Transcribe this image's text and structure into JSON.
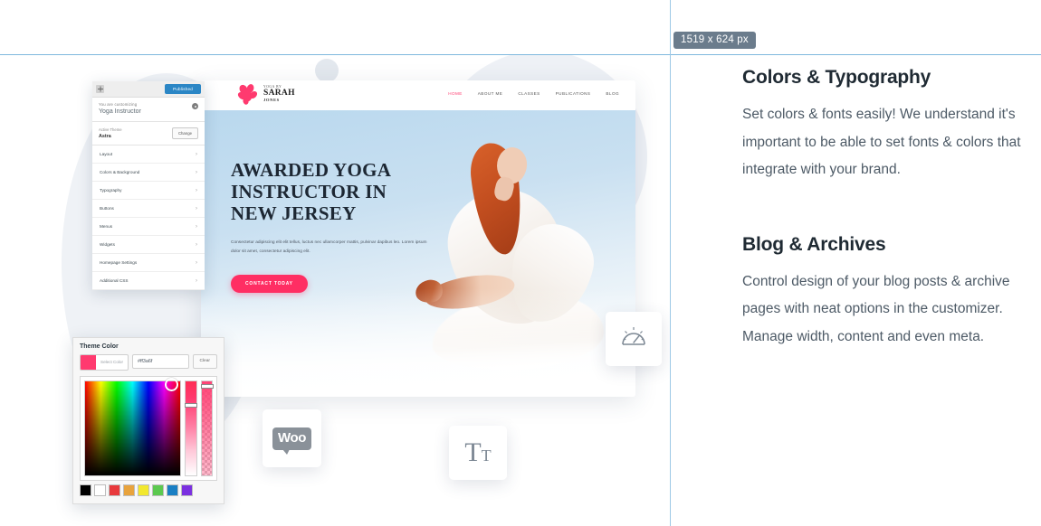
{
  "overlay": {
    "size_badge": "1519 x 624 px"
  },
  "customizer": {
    "publish_label": "Published",
    "close_icon": "close-icon",
    "customizing_label": "You are customizing",
    "site_title": "Yoga Instructor",
    "gear_icon": "gear-icon",
    "active_theme_label": "Active Theme",
    "active_theme_name": "Astra",
    "change_label": "Change",
    "menu_items": [
      {
        "label": "Layout"
      },
      {
        "label": "Colors & Background"
      },
      {
        "label": "Typography"
      },
      {
        "label": "Buttons"
      },
      {
        "label": "Menus"
      },
      {
        "label": "Widgets"
      },
      {
        "label": "Homepage Settings"
      },
      {
        "label": "Additional CSS"
      }
    ],
    "chevron": "›"
  },
  "color_picker": {
    "title": "Theme Color",
    "select_color_label": "Select Color",
    "hex_value": "#ff3a6f",
    "clear_label": "Clear",
    "current_color": "#ff3a6f",
    "swatches": [
      "#000000",
      "#ffffff",
      "#e8393c",
      "#e8a33d",
      "#f2e82e",
      "#5cc94f",
      "#1a7fc4",
      "#7b30e0"
    ]
  },
  "site": {
    "logo_small": "YOGA BY",
    "logo_name": "SARAH",
    "logo_sub": "JONES",
    "nav": [
      {
        "label": "HOME",
        "active": true
      },
      {
        "label": "ABOUT ME",
        "active": false
      },
      {
        "label": "CLASSES",
        "active": false
      },
      {
        "label": "PUBLICATIONS",
        "active": false
      },
      {
        "label": "BLOG",
        "active": false
      }
    ],
    "hero_title_line1": "AWARDED YOGA",
    "hero_title_line2": "INSTRUCTOR IN",
    "hero_title_line3": "NEW JERSEY",
    "hero_body": "Consectetur adipiscing elit elit tellus, luctus nec ullamcorper mattis, pulvinar dapibus leo. Lorem ipsum dolor sit amet, consectetur adipiscing elit.",
    "cta_label": "CONTACT TODAY"
  },
  "icon_cards": [
    {
      "name": "woocommerce-icon",
      "label": "Woo"
    },
    {
      "name": "typography-icon",
      "label": "Tt"
    },
    {
      "name": "speedometer-icon",
      "label": ""
    }
  ],
  "features": [
    {
      "title": "Colors & Typography",
      "body": "Set colors & fonts easily! We understand it's important to be able to set fonts & colors that integrate with your brand."
    },
    {
      "title": "Blog & Archives",
      "body": "Control design of your blog posts & archive pages with neat options in the customizer. Manage width, content and even meta."
    }
  ],
  "colors": {
    "accent": "#ff3a6f",
    "guide": "#7fb8dd",
    "badge_bg": "#6b7c8c",
    "heading": "#1f2a33",
    "body_text": "#4d5a66"
  }
}
